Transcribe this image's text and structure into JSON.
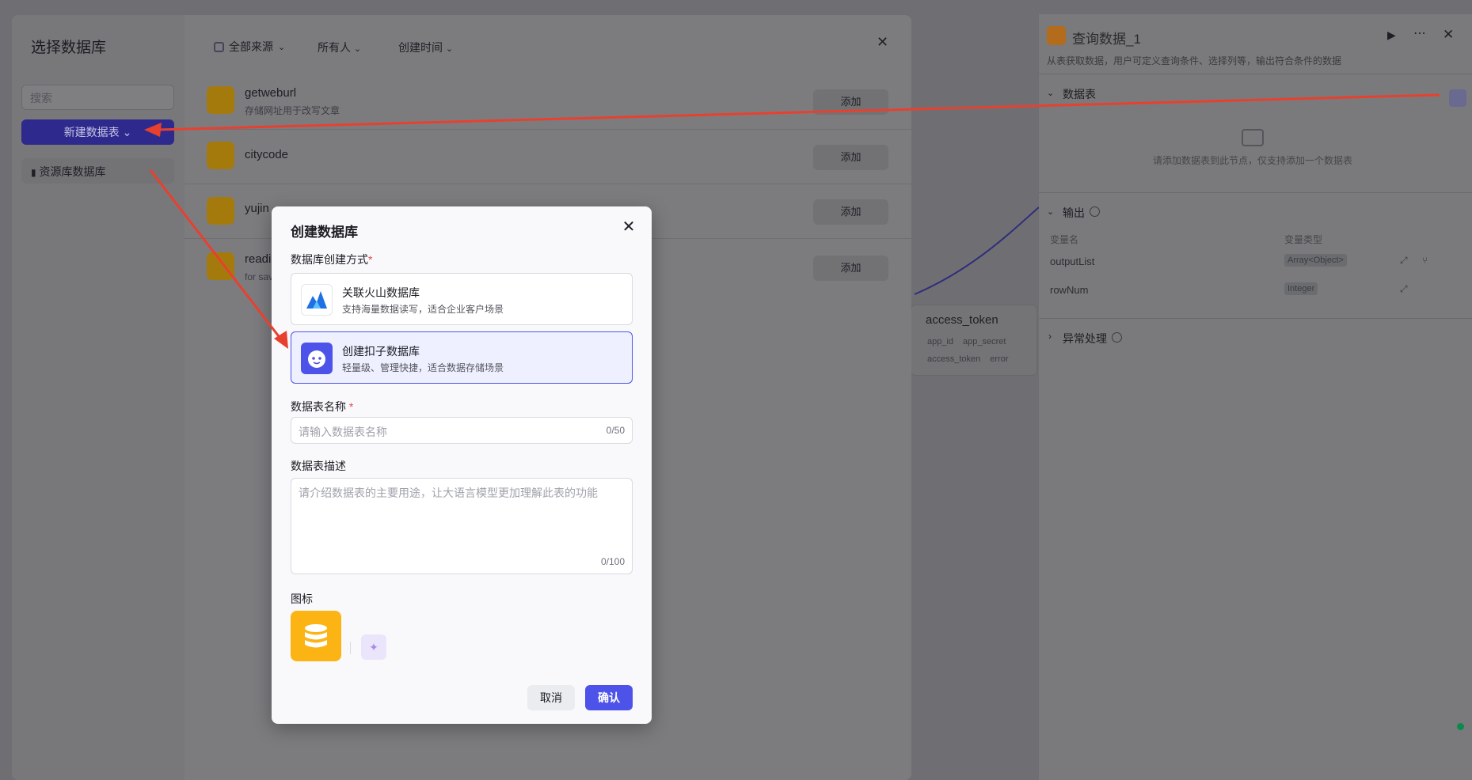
{
  "right_panel": {
    "title": "查询数据_1",
    "description": "从表获取数据，用户可定义查询条件、选择列等，输出符合条件的数据",
    "section_table": "数据表",
    "empty_hint": "请添加数据表到此节点，仅支持添加一个数据表",
    "section_output": "输出",
    "col_var_name": "变量名",
    "col_var_type": "变量类型",
    "outputs": [
      {
        "name": "outputList",
        "type": "Array<Object>"
      },
      {
        "name": "rowNum",
        "type": "Integer"
      }
    ],
    "section_exception": "异常处理"
  },
  "canvas": {
    "node_title": "access_token",
    "params": [
      "app_id",
      "app_secret",
      "access_token",
      "error"
    ]
  },
  "select_db_modal": {
    "title": "选择数据库",
    "search_placeholder": "搜索",
    "new_table_button": "新建数据表",
    "resource_item": "资源库数据库",
    "filters": {
      "source": "全部来源",
      "owner": "所有人",
      "time": "创建时间"
    },
    "rows": [
      {
        "title": "getweburl",
        "subtitle": "存储网址用于改写文章",
        "add": "添加"
      },
      {
        "title": "citycode",
        "subtitle": "",
        "add": "添加"
      },
      {
        "title": "yujin",
        "subtitle": "",
        "add": "添加"
      },
      {
        "title": "readi",
        "subtitle": "for sav",
        "add": "添加"
      }
    ]
  },
  "create_db_modal": {
    "title": "创建数据库",
    "method_label": "数据库创建方式",
    "options": [
      {
        "title": "关联火山数据库",
        "subtitle": "支持海量数据读写，适合企业客户场景"
      },
      {
        "title": "创建扣子数据库",
        "subtitle": "轻量级、管理快捷，适合数据存储场景"
      }
    ],
    "name_label": "数据表名称",
    "name_placeholder": "请输入数据表名称",
    "name_counter": "0/50",
    "desc_label": "数据表描述",
    "desc_placeholder": "请介绍数据表的主要用途，让大语言模型更加理解此表的功能",
    "desc_counter": "0/100",
    "icon_label": "图标",
    "cancel": "取消",
    "confirm": "确认"
  },
  "colors": {
    "accent": "#4d53e8",
    "db_icon": "#fbb413",
    "arrow": "#e8402f"
  }
}
